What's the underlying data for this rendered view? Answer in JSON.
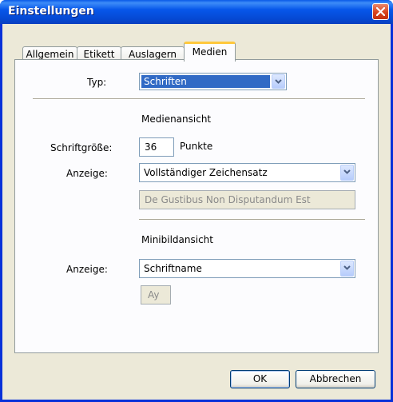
{
  "window": {
    "title": "Einstellungen"
  },
  "tabs": [
    "Allgemein",
    "Etikett",
    "Auslagern",
    "Medien"
  ],
  "type_section": {
    "label": "Typ:",
    "value": "Schriften"
  },
  "media_view": {
    "heading": "Medienansicht",
    "size_label": "Schriftgröße:",
    "size_value": "36",
    "size_unit": "Punkte",
    "display_label": "Anzeige:",
    "display_value": "Vollständiger Zeichensatz",
    "preview_text": "De Gustibus Non Disputandum Est"
  },
  "thumb_view": {
    "heading": "Minibildansicht",
    "display_label": "Anzeige:",
    "display_value": "Schriftname",
    "preview_text": "Ay"
  },
  "buttons": {
    "ok": "OK",
    "cancel": "Abbrechen"
  },
  "colors": {
    "titlebar": "#0757ea",
    "tab_highlight": "#ffc83c",
    "selection": "#316ac5",
    "dialog_bg": "#ece9d8"
  }
}
